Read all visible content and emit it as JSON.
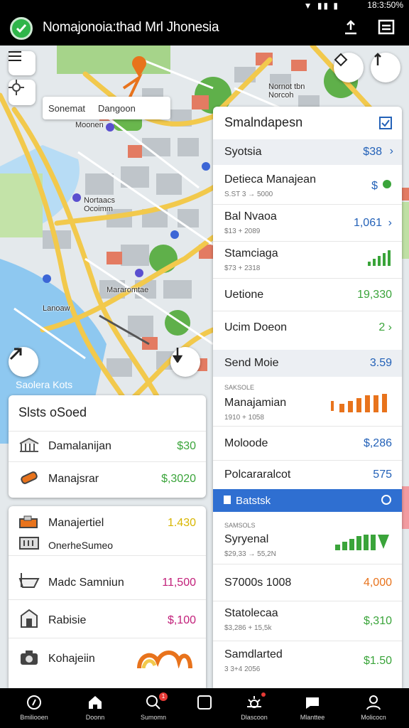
{
  "status_bar": {
    "time": "18:3:50%"
  },
  "app_bar": {
    "title": "Nomajonoia:thad Mrl Jhonesia"
  },
  "search": {
    "text_a": "Sonemat",
    "text_b": "Dangoon"
  },
  "map_labels": [
    "Moonen",
    "Nortaacs\nOcoimm",
    "Mararomtae",
    "Lanoaw",
    "Nornot tbn\nNorcoh",
    "Saolera Kots"
  ],
  "panel_left": {
    "title": "Slsts oSoed",
    "rows": [
      {
        "label": "Damalanijan",
        "value": "$30",
        "color": "#3aa43a"
      },
      {
        "label": "Manajsrar",
        "value": "$,3020",
        "color": "#3aa43a"
      }
    ]
  },
  "panel_left2": {
    "rows": [
      {
        "label": "Manajertiel",
        "value": "1.430",
        "color": "#d8b600"
      },
      {
        "label": "OnerheSumeo",
        "value": "",
        "color": "#222"
      },
      {
        "label": "Madc Samniun",
        "value": "11,500",
        "color": "#c2207a"
      },
      {
        "label": "Rabisie",
        "value": "$,100",
        "color": "#c2207a"
      },
      {
        "label": "Kohajeiin",
        "value": "",
        "color": "#222"
      }
    ]
  },
  "panel_right": {
    "title": "Smalndapesn",
    "section1": {
      "label": "Syotsia",
      "value": "$38"
    },
    "rows1": [
      {
        "label": "Detieca Manajean",
        "sub": "S.ST 3 → 5000",
        "value": "$",
        "color": "#2462b8"
      },
      {
        "label": "Bal Nvaoa",
        "sub": "$13 + 2089",
        "value": "1,061",
        "color": "#2462b8"
      },
      {
        "label": "Stamciaga",
        "sub": "$73 + 2318",
        "value": "",
        "color": "#3aa43a"
      },
      {
        "label": "Uetione",
        "sub": "",
        "value": "19,330",
        "color": "#3aa43a"
      },
      {
        "label": "Ucim Doeon",
        "sub": "",
        "value": "2 ›",
        "color": "#3aa43a"
      }
    ],
    "section2": {
      "label": "Send Moie",
      "value": "3.59"
    },
    "rows2": [
      {
        "label": "Manajamian",
        "sub": "1910 + 1058",
        "kicker": "SAKSOLE",
        "value": "",
        "color": "#e8731c"
      },
      {
        "label": "Moloode",
        "sub": "",
        "value": "$,286",
        "color": "#2462b8"
      },
      {
        "label": "Polcararalcot",
        "sub": "",
        "value": "575",
        "color": "#2462b8"
      }
    ],
    "section3": {
      "label": "Batstsk"
    },
    "rows3": [
      {
        "label": "Syryenal",
        "sub": "$29,33 → 55,2N",
        "kicker": "SAMSOLS",
        "value": "",
        "color": "#3aa43a"
      },
      {
        "label": "S7000s 1008",
        "sub": "",
        "value": "4,000",
        "color": "#e8731c"
      },
      {
        "label": "Statolecaa",
        "sub": "$3,286 + 15,5k",
        "value": "$,310",
        "color": "#3aa43a"
      },
      {
        "label": "Samdlarted",
        "sub": "3 3+4 2056",
        "value": "$1.50",
        "color": "#3aa43a"
      }
    ]
  },
  "bottom_nav": [
    "Bmiliooen",
    "Doonn",
    "Sumomn",
    "",
    "Dlascoon",
    "Mlanttee",
    "Molicocn"
  ],
  "colors": {
    "accent_green": "#2fb54a",
    "accent_blue": "#2462b8",
    "section_blue": "#2f6fd1"
  }
}
